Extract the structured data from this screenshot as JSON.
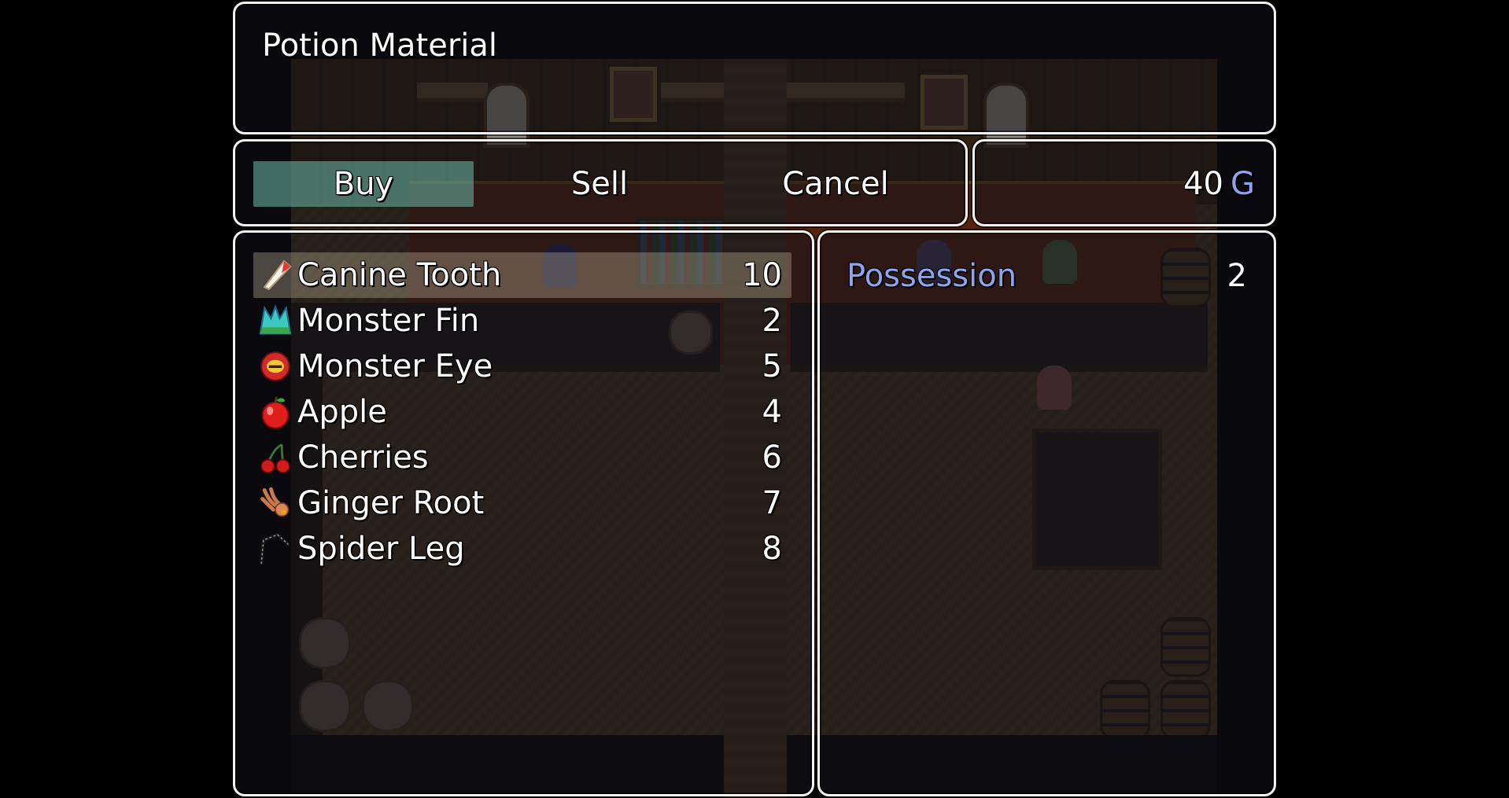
{
  "help": {
    "text": "Potion Material"
  },
  "commands": [
    {
      "label": "Buy",
      "selected": true
    },
    {
      "label": "Sell",
      "selected": false
    },
    {
      "label": "Cancel",
      "selected": false
    }
  ],
  "gold": {
    "amount": "40",
    "unit": "G"
  },
  "items": [
    {
      "name": "Canine Tooth",
      "price": "10",
      "icon": "canine-tooth-icon",
      "selected": true
    },
    {
      "name": "Monster Fin",
      "price": "2",
      "icon": "monster-fin-icon",
      "selected": false
    },
    {
      "name": "Monster Eye",
      "price": "5",
      "icon": "monster-eye-icon",
      "selected": false
    },
    {
      "name": "Apple",
      "price": "4",
      "icon": "apple-icon",
      "selected": false
    },
    {
      "name": "Cherries",
      "price": "6",
      "icon": "cherries-icon",
      "selected": false
    },
    {
      "name": "Ginger Root",
      "price": "7",
      "icon": "ginger-root-icon",
      "selected": false
    },
    {
      "name": "Spider Leg",
      "price": "8",
      "icon": "spider-leg-icon",
      "selected": false
    }
  ],
  "status": {
    "possession_label": "Possession",
    "possession_value": "2"
  },
  "colors": {
    "system_text": "#8fa4ec",
    "window_border": "#f2f2f2",
    "command_cursor": "#6ebeaa"
  }
}
